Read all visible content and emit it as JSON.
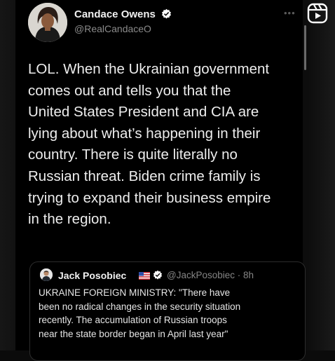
{
  "post": {
    "author_name": "Candace Owens",
    "author_handle": "@RealCandaceO",
    "body": "LOL. When the Ukrainian government\ncomes out and tells you that the\nUnited States President and CIA are\nlying about what’s happening in their\ncountry. There is quite literally no\nRussian threat. Biden crime family is\ntrying to expand their business empire\nin the region."
  },
  "quote": {
    "author_name": "Jack Posobiec",
    "author_handle_time": "@JackPosobiec · 8h",
    "body": "UKRAINE FOREIGN MINISTRY: \"There have\nbeen no radical changes in the security situation\nrecently. The accumulation of Russian troops\nnear the state border began in April last year\""
  },
  "icons": {
    "verified": "verified-check-icon",
    "flag": "us-flag-icon",
    "more": "more-dots-icon",
    "reels": "reels-icon"
  },
  "colors": {
    "background": "#000000",
    "text": "#ededed",
    "muted": "#8b8b8b",
    "verified": "#ffffff"
  }
}
